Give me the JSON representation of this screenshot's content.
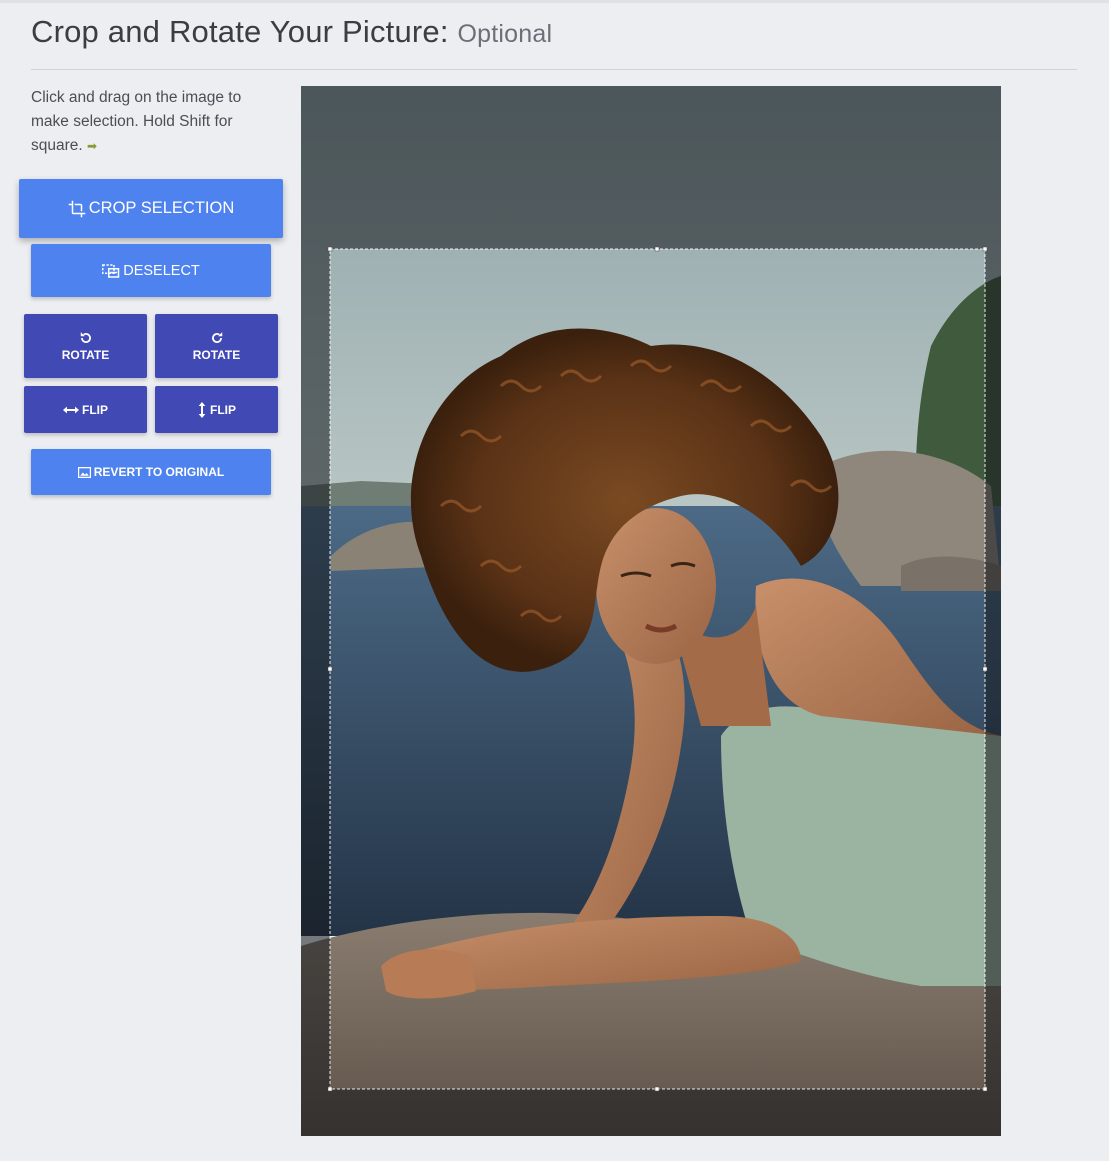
{
  "header": {
    "title": "Crop and Rotate Your Picture:",
    "subtitle": "Optional"
  },
  "instructions": {
    "text": "Click and drag on the image to make selection. Hold Shift for square.",
    "arrow_icon": "arrow-right-icon"
  },
  "toolbar": {
    "crop_label": "CROP SELECTION",
    "deselect_label": "DESELECT",
    "rotate_left_label": "ROTATE",
    "rotate_right_label": "ROTATE",
    "flip_horizontal_label": "FLIP",
    "flip_vertical_label": "FLIP",
    "revert_label": "REVERT TO ORIGINAL"
  },
  "icons": {
    "crop": "crop-icon",
    "deselect": "deselect-icon",
    "rotate_left": "rotate-left-icon",
    "rotate_right": "rotate-right-icon",
    "flip_horizontal": "flip-horizontal-icon",
    "flip_vertical": "flip-vertical-icon",
    "revert": "image-icon"
  },
  "colors": {
    "primary_button": "#4e82ee",
    "secondary_button": "#4149b4",
    "background": "#eceef2"
  }
}
